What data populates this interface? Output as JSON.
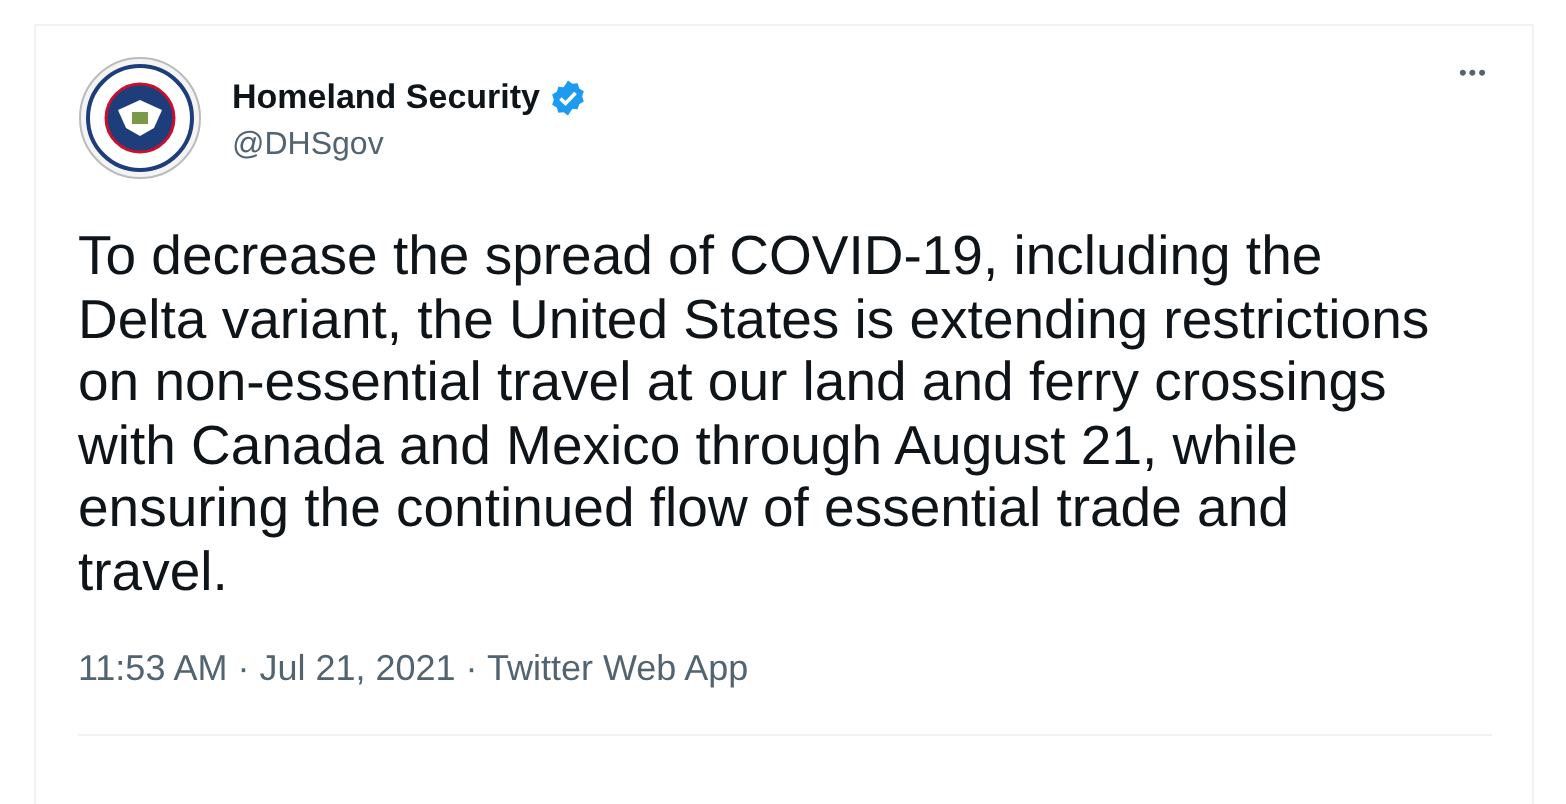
{
  "author": {
    "name": "Homeland Security",
    "verified": true,
    "handle": "@DHSgov"
  },
  "more_button": "•••",
  "tweet_lines": [
    "To decrease the spread of COVID-19, including the",
    "Delta variant, the United States is extending restrictions",
    "on non-essential travel at our land and ferry crossings",
    "with Canada and Mexico through August 21, while",
    "ensuring the continued flow of essential trade and",
    "travel."
  ],
  "meta": "11:53 AM · Jul 21, 2021 · Twitter Web App"
}
